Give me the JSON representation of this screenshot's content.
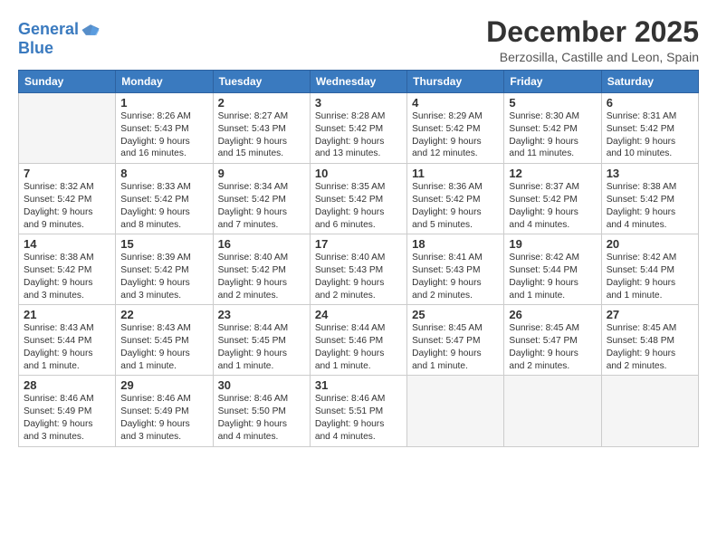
{
  "logo": {
    "line1": "General",
    "line2": "Blue"
  },
  "title": "December 2025",
  "subtitle": "Berzosilla, Castille and Leon, Spain",
  "days_header": [
    "Sunday",
    "Monday",
    "Tuesday",
    "Wednesday",
    "Thursday",
    "Friday",
    "Saturday"
  ],
  "weeks": [
    [
      {
        "day": "",
        "info": ""
      },
      {
        "day": "1",
        "info": "Sunrise: 8:26 AM\nSunset: 5:43 PM\nDaylight: 9 hours\nand 16 minutes."
      },
      {
        "day": "2",
        "info": "Sunrise: 8:27 AM\nSunset: 5:43 PM\nDaylight: 9 hours\nand 15 minutes."
      },
      {
        "day": "3",
        "info": "Sunrise: 8:28 AM\nSunset: 5:42 PM\nDaylight: 9 hours\nand 13 minutes."
      },
      {
        "day": "4",
        "info": "Sunrise: 8:29 AM\nSunset: 5:42 PM\nDaylight: 9 hours\nand 12 minutes."
      },
      {
        "day": "5",
        "info": "Sunrise: 8:30 AM\nSunset: 5:42 PM\nDaylight: 9 hours\nand 11 minutes."
      },
      {
        "day": "6",
        "info": "Sunrise: 8:31 AM\nSunset: 5:42 PM\nDaylight: 9 hours\nand 10 minutes."
      }
    ],
    [
      {
        "day": "7",
        "info": "Sunrise: 8:32 AM\nSunset: 5:42 PM\nDaylight: 9 hours\nand 9 minutes."
      },
      {
        "day": "8",
        "info": "Sunrise: 8:33 AM\nSunset: 5:42 PM\nDaylight: 9 hours\nand 8 minutes."
      },
      {
        "day": "9",
        "info": "Sunrise: 8:34 AM\nSunset: 5:42 PM\nDaylight: 9 hours\nand 7 minutes."
      },
      {
        "day": "10",
        "info": "Sunrise: 8:35 AM\nSunset: 5:42 PM\nDaylight: 9 hours\nand 6 minutes."
      },
      {
        "day": "11",
        "info": "Sunrise: 8:36 AM\nSunset: 5:42 PM\nDaylight: 9 hours\nand 5 minutes."
      },
      {
        "day": "12",
        "info": "Sunrise: 8:37 AM\nSunset: 5:42 PM\nDaylight: 9 hours\nand 4 minutes."
      },
      {
        "day": "13",
        "info": "Sunrise: 8:38 AM\nSunset: 5:42 PM\nDaylight: 9 hours\nand 4 minutes."
      }
    ],
    [
      {
        "day": "14",
        "info": "Sunrise: 8:38 AM\nSunset: 5:42 PM\nDaylight: 9 hours\nand 3 minutes."
      },
      {
        "day": "15",
        "info": "Sunrise: 8:39 AM\nSunset: 5:42 PM\nDaylight: 9 hours\nand 3 minutes."
      },
      {
        "day": "16",
        "info": "Sunrise: 8:40 AM\nSunset: 5:42 PM\nDaylight: 9 hours\nand 2 minutes."
      },
      {
        "day": "17",
        "info": "Sunrise: 8:40 AM\nSunset: 5:43 PM\nDaylight: 9 hours\nand 2 minutes."
      },
      {
        "day": "18",
        "info": "Sunrise: 8:41 AM\nSunset: 5:43 PM\nDaylight: 9 hours\nand 2 minutes."
      },
      {
        "day": "19",
        "info": "Sunrise: 8:42 AM\nSunset: 5:44 PM\nDaylight: 9 hours\nand 1 minute."
      },
      {
        "day": "20",
        "info": "Sunrise: 8:42 AM\nSunset: 5:44 PM\nDaylight: 9 hours\nand 1 minute."
      }
    ],
    [
      {
        "day": "21",
        "info": "Sunrise: 8:43 AM\nSunset: 5:44 PM\nDaylight: 9 hours\nand 1 minute."
      },
      {
        "day": "22",
        "info": "Sunrise: 8:43 AM\nSunset: 5:45 PM\nDaylight: 9 hours\nand 1 minute."
      },
      {
        "day": "23",
        "info": "Sunrise: 8:44 AM\nSunset: 5:45 PM\nDaylight: 9 hours\nand 1 minute."
      },
      {
        "day": "24",
        "info": "Sunrise: 8:44 AM\nSunset: 5:46 PM\nDaylight: 9 hours\nand 1 minute."
      },
      {
        "day": "25",
        "info": "Sunrise: 8:45 AM\nSunset: 5:47 PM\nDaylight: 9 hours\nand 1 minute."
      },
      {
        "day": "26",
        "info": "Sunrise: 8:45 AM\nSunset: 5:47 PM\nDaylight: 9 hours\nand 2 minutes."
      },
      {
        "day": "27",
        "info": "Sunrise: 8:45 AM\nSunset: 5:48 PM\nDaylight: 9 hours\nand 2 minutes."
      }
    ],
    [
      {
        "day": "28",
        "info": "Sunrise: 8:46 AM\nSunset: 5:49 PM\nDaylight: 9 hours\nand 3 minutes."
      },
      {
        "day": "29",
        "info": "Sunrise: 8:46 AM\nSunset: 5:49 PM\nDaylight: 9 hours\nand 3 minutes."
      },
      {
        "day": "30",
        "info": "Sunrise: 8:46 AM\nSunset: 5:50 PM\nDaylight: 9 hours\nand 4 minutes."
      },
      {
        "day": "31",
        "info": "Sunrise: 8:46 AM\nSunset: 5:51 PM\nDaylight: 9 hours\nand 4 minutes."
      },
      {
        "day": "",
        "info": ""
      },
      {
        "day": "",
        "info": ""
      },
      {
        "day": "",
        "info": ""
      }
    ]
  ]
}
